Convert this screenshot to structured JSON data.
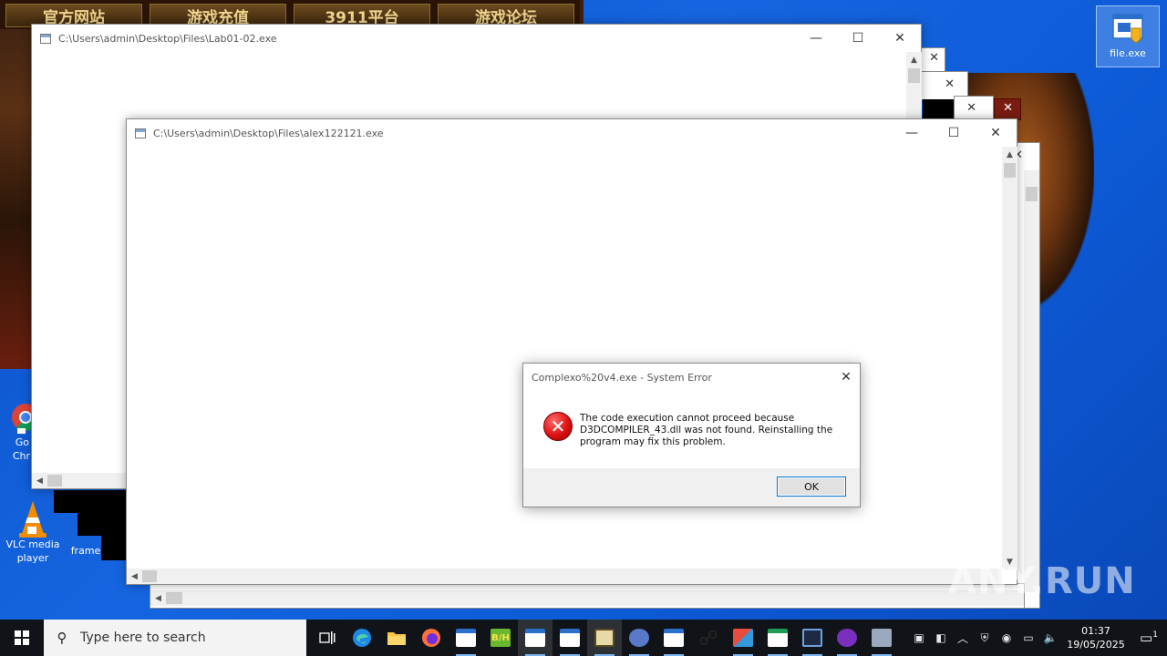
{
  "wallpaper": {
    "banner": [
      "官方网站",
      "游戏充值",
      "3911平台",
      "游戏论坛"
    ]
  },
  "desktop_icons": {
    "file_exe": "file.exe",
    "chrome_line1": "Go",
    "chrome_line2": "Chr",
    "vlc_line1": "VLC media",
    "vlc_line2": "player",
    "frame": "frame"
  },
  "window_back": {
    "title": "C:\\Users\\admin\\Desktop\\Files\\Lab01-02.exe",
    "minimize": "—",
    "maximize": "☐",
    "close": "✕"
  },
  "window_front": {
    "title": "C:\\Users\\admin\\Desktop\\Files\\alex122121.exe",
    "minimize": "—",
    "maximize": "☐",
    "close": "✕"
  },
  "ghost_close": "✕",
  "dialog": {
    "title": "Complexo%20v4.exe - System Error",
    "close": "✕",
    "message": "The code execution cannot proceed because D3DCOMPILER_43.dll was not found. Reinstalling the program may fix this problem.",
    "ok_label": "OK"
  },
  "taskbar": {
    "search_placeholder": "Type here to search",
    "clock_time": "01:37",
    "clock_date": "19/05/2025",
    "notification_count": "1"
  },
  "watermark": "ANY.RUN",
  "colors": {
    "desktop_blue": "#0d5ad6",
    "taskbar": "#101418",
    "error_red": "#d11111",
    "accent": "#0078d7"
  }
}
